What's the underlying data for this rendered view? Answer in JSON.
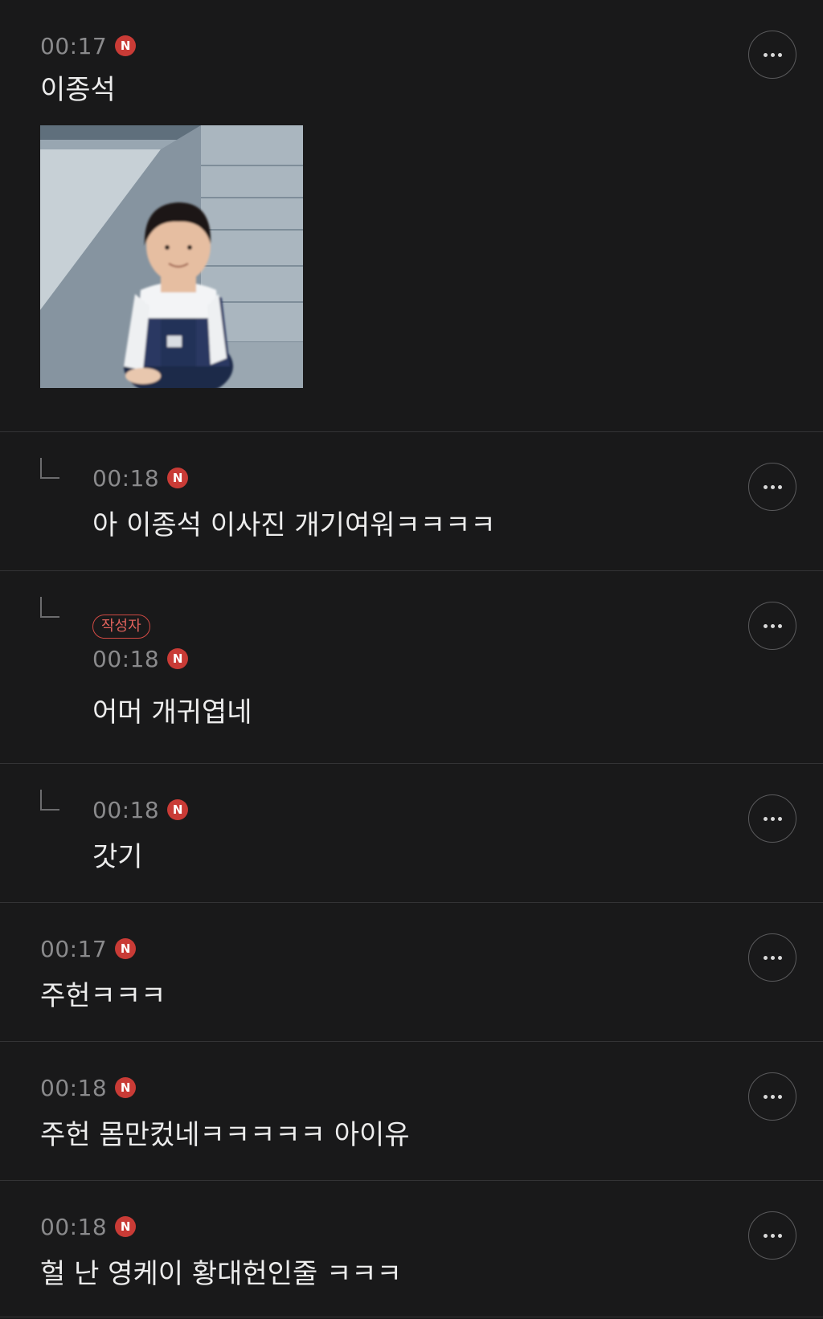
{
  "comments": [
    {
      "time": "00:17",
      "badge": "N",
      "text": "이종석",
      "has_photo": true
    },
    {
      "time": "00:18",
      "badge": "N",
      "text": "아 이종석 이사진 개기여워ㅋㅋㅋㅋ",
      "reply": true
    },
    {
      "time": "00:18",
      "badge": "N",
      "text": "어머 개귀엽네",
      "reply": true,
      "author_tag": "작성자"
    },
    {
      "time": "00:18",
      "badge": "N",
      "text": "갓기",
      "reply": true
    },
    {
      "time": "00:17",
      "badge": "N",
      "text": "주헌ㅋㅋㅋ"
    },
    {
      "time": "00:18",
      "badge": "N",
      "text": "주헌 몸만컸네ㅋㅋㅋㅋㅋ 아이유"
    },
    {
      "time": "00:18",
      "badge": "N",
      "text": "헐 난 영케이 황대헌인줄 ㅋㅋㅋ"
    }
  ],
  "colors": {
    "background": "#19191a",
    "badge": "#c93b36",
    "author_tag": "#d04a44"
  },
  "icons": {
    "more": "more-horizontal-icon",
    "reply": "reply-arrow-icon"
  }
}
